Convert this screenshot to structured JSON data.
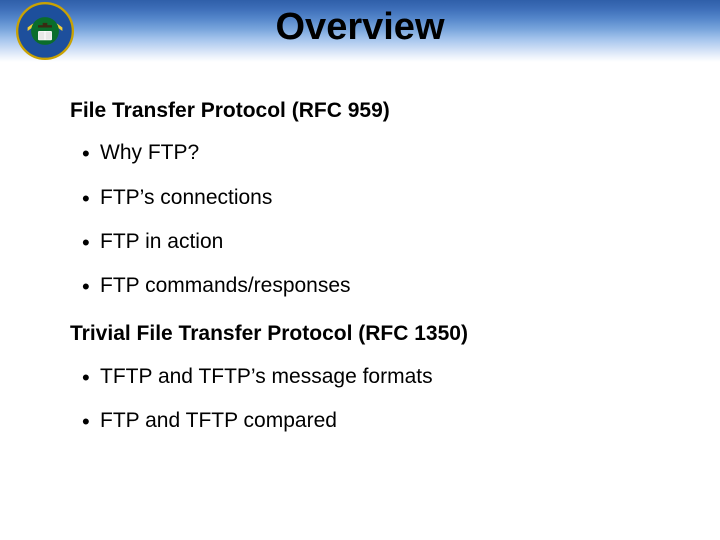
{
  "title": "Overview",
  "sections": [
    {
      "heading": "File Transfer Protocol (RFC 959)",
      "bullets": [
        "Why FTP?",
        "FTP’s connections",
        "FTP in action",
        "FTP commands/responses"
      ]
    },
    {
      "heading": "Trivial File Transfer Protocol (RFC 1350)",
      "bullets": [
        "TFTP and TFTP’s message formats",
        "FTP and TFTP compared"
      ]
    }
  ]
}
